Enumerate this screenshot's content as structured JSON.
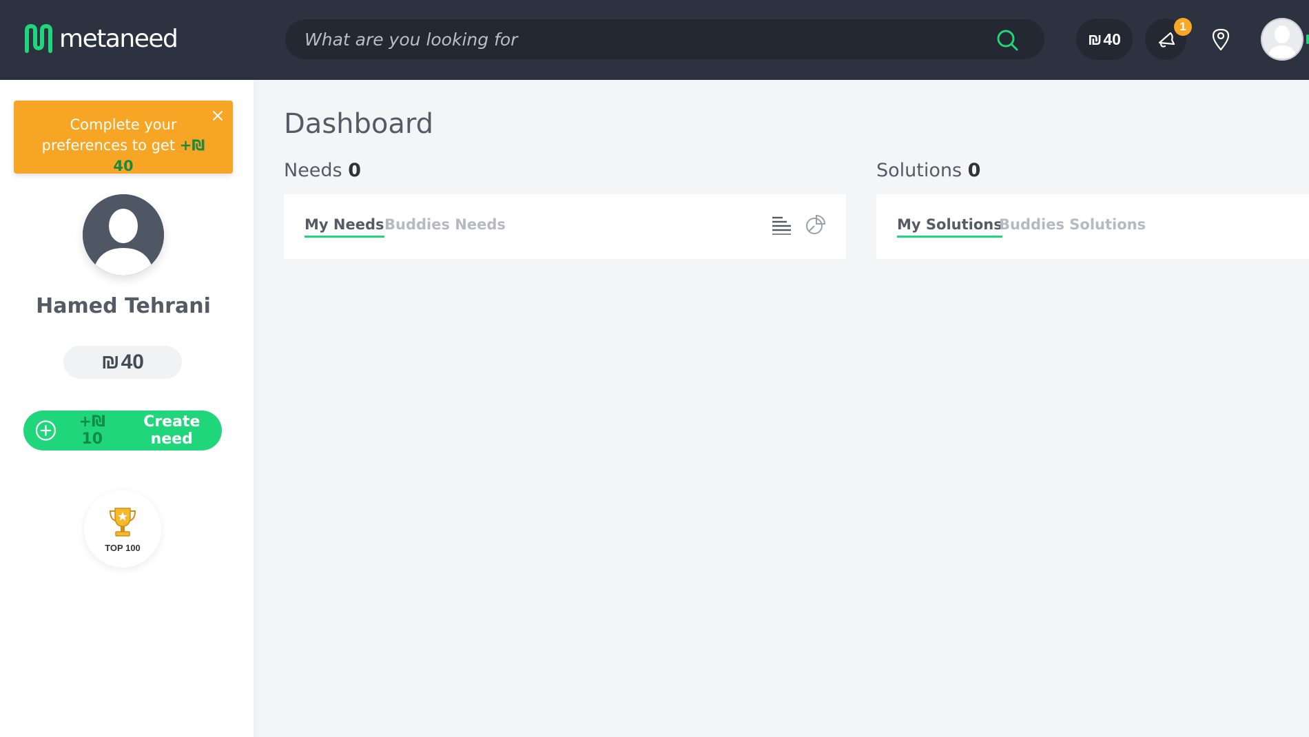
{
  "header": {
    "logo_text": "metaneed",
    "search_placeholder": "What are you looking for",
    "coin_symbol": "₪",
    "coin_amount": "40",
    "notification_count": "1"
  },
  "sidebar": {
    "promo_text": "Complete your preferences to get",
    "promo_bonus": "+₪ 40",
    "user_name": "Hamed Tehrani",
    "balance_symbol": "₪",
    "balance_amount": "40",
    "create_bonus": "+₪ 10",
    "create_label": "Create need",
    "top100_label": "TOP 100"
  },
  "main": {
    "title": "Dashboard",
    "needs": {
      "label": "Needs",
      "count": "0",
      "tabs": [
        "My Needs",
        "Buddies Needs"
      ]
    },
    "solutions": {
      "label": "Solutions",
      "count": "0",
      "tabs": [
        "My Solutions",
        "Buddies Solutions"
      ]
    }
  },
  "colors": {
    "header_bg": "#2c3240",
    "accent_green": "#1fd67a",
    "promo_orange": "#f6a524",
    "badge_yellow": "#f9a825"
  }
}
